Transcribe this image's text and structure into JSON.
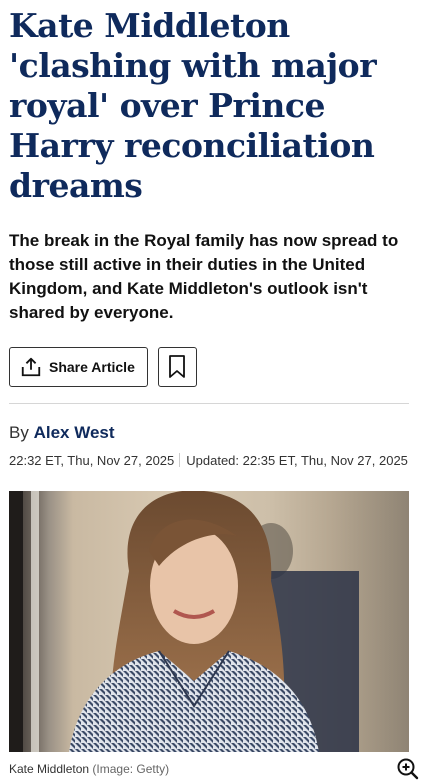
{
  "article": {
    "headline": "Kate Middleton 'clashing with major royal' over Prince Harry reconciliation dreams",
    "standfirst": "The break in the Royal family has now spread to those still active in their duties in the United Kingdom, and Kate Middleton's outlook isn't shared by everyone.",
    "share_label": "Share Article",
    "byline_prefix": "By",
    "author": "Alex West",
    "published": "22:32 ET, Thu, Nov 27, 2025",
    "updated": "Updated: 22:35 ET, Thu, Nov 27, 2025"
  },
  "image": {
    "caption": "Kate Middleton",
    "credit": "(Image: Getty)"
  },
  "icons": {
    "share": "share-icon",
    "bookmark": "bookmark-icon",
    "zoom": "zoom-in-icon"
  },
  "colors": {
    "headline": "#0f2a5c",
    "author": "#0f2a5c"
  }
}
